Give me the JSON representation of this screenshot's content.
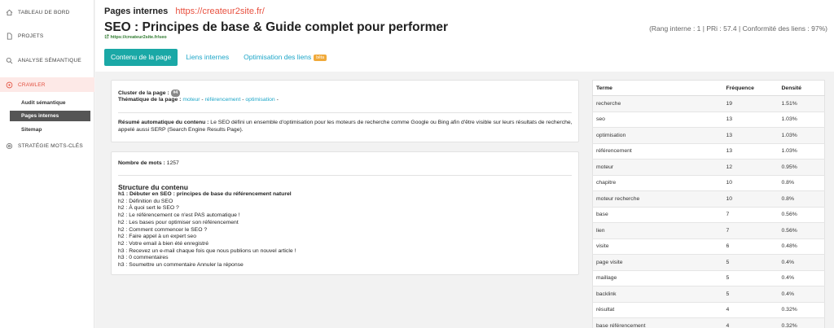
{
  "sidebar": {
    "items": [
      {
        "label": "TABLEAU DE BORD",
        "icon": "home-icon"
      },
      {
        "label": "PROJETS",
        "icon": "document-icon"
      },
      {
        "label": "ANALYSE SÉMANTIQUE",
        "icon": "search-icon"
      },
      {
        "label": "CRAWLER",
        "icon": "target-icon"
      },
      {
        "label": "STRATÉGIE MOTS-CLÉS",
        "icon": "gear-icon"
      }
    ],
    "sub_items": [
      "Audit sémantique",
      "Pages internes",
      "Sitemap"
    ]
  },
  "header": {
    "breadcrumb": "Pages internes",
    "site_url": "https://createur2site.fr/",
    "title": "SEO : Principes de base & Guide complet pour performer",
    "page_link": "https://createur2site.fr/seo",
    "rank_info": "(Rang interne : 1 | PRi : 57.4 | Conformité des liens : 97%)"
  },
  "tabs": [
    "Contenu de la page",
    "Liens internes",
    "Optimisation des liens"
  ],
  "beta_label": "bêta",
  "card1": {
    "cluster_label": "Cluster de la page :",
    "cluster_badge": "#4",
    "theme_label": "Thématique de la page :",
    "themes": [
      "moteur",
      "référencement",
      "optimisation"
    ],
    "summary_label": "Résumé automatique du contenu :",
    "summary_text": "Le SEO défini un ensemble d'optimisation pour les moteurs de recherche comme Google ou Bing afin d'être visible sur leurs résultats de recherche, appelé aussi SERP (Search Engine Results Page)."
  },
  "card2": {
    "word_count_label": "Nombre de mots :",
    "word_count": "1257",
    "structure_title": "Structure du contenu",
    "headings": [
      "h1 : Débuter en SEO : principes de base du référencement naturel",
      "h2 : Définition du SEO",
      "h2 : À quoi sert le SEO ?",
      "h2 : Le référencement ce n'est PAS automatique !",
      "h2 : Les bases pour optimiser son référencement",
      "h2 : Comment commencer le SEO ?",
      "h2 : Faire appel à un expert seo",
      "h2 : Votre email à bien été enregistré",
      "h3 : Recevez un e-mail chaque fois que nous publions un nouvel article !",
      "h3 : 0 commentaires",
      "h3 : Soumettre un commentaire Annuler la réponse"
    ]
  },
  "table": {
    "headers": [
      "Terme",
      "Fréquence",
      "Densité"
    ],
    "rows": [
      [
        "recherche",
        "19",
        "1.51%"
      ],
      [
        "seo",
        "13",
        "1.03%"
      ],
      [
        "optimisation",
        "13",
        "1.03%"
      ],
      [
        "référencement",
        "13",
        "1.03%"
      ],
      [
        "moteur",
        "12",
        "0.95%"
      ],
      [
        "chapitre",
        "10",
        "0.8%"
      ],
      [
        "moteur recherche",
        "10",
        "0.8%"
      ],
      [
        "base",
        "7",
        "0.56%"
      ],
      [
        "lien",
        "7",
        "0.56%"
      ],
      [
        "visite",
        "6",
        "0.48%"
      ],
      [
        "page visite",
        "5",
        "0.4%"
      ],
      [
        "maillage",
        "5",
        "0.4%"
      ],
      [
        "backlink",
        "5",
        "0.4%"
      ],
      [
        "résultat",
        "4",
        "0.32%"
      ],
      [
        "base référencement",
        "4",
        "0.32%"
      ]
    ]
  },
  "colors": {
    "accent": "#1aa8a6",
    "link": "#1ea6c8",
    "brand": "#e8503f",
    "beta": "#f0a93a"
  }
}
